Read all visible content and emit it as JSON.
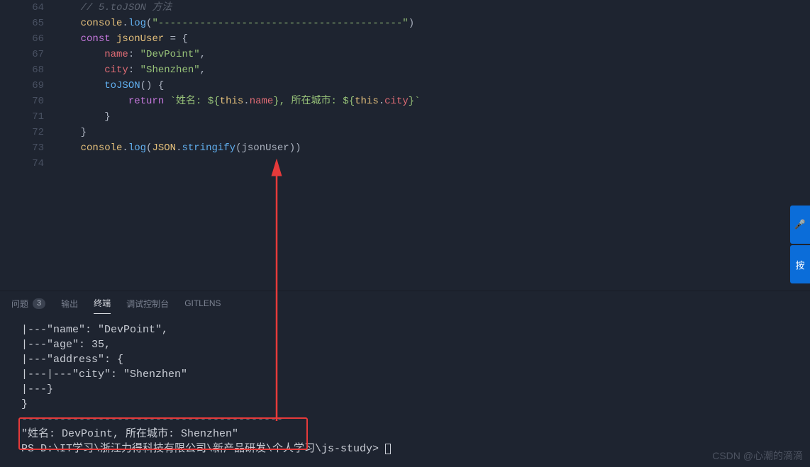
{
  "editor": {
    "lines": [
      {
        "num": "64",
        "indent": 1,
        "tokens": [
          {
            "t": "comment",
            "v": "// 5.toJSON 方法"
          }
        ]
      },
      {
        "num": "65",
        "indent": 1,
        "tokens": [
          {
            "t": "builtin",
            "v": "console"
          },
          {
            "t": "punct",
            "v": "."
          },
          {
            "t": "method",
            "v": "log"
          },
          {
            "t": "punct",
            "v": "("
          },
          {
            "t": "string",
            "v": "\"-----------------------------------------\""
          },
          {
            "t": "punct",
            "v": ")"
          }
        ]
      },
      {
        "num": "66",
        "indent": 1,
        "tokens": [
          {
            "t": "keyword",
            "v": "const"
          },
          {
            "t": "identifier",
            "v": " "
          },
          {
            "t": "builtin",
            "v": "jsonUser"
          },
          {
            "t": "identifier",
            "v": " "
          },
          {
            "t": "punct",
            "v": "="
          },
          {
            "t": "identifier",
            "v": " "
          },
          {
            "t": "punct",
            "v": "{"
          }
        ]
      },
      {
        "num": "67",
        "indent": 2,
        "tokens": [
          {
            "t": "prop",
            "v": "name"
          },
          {
            "t": "punct",
            "v": ": "
          },
          {
            "t": "string",
            "v": "\"DevPoint\""
          },
          {
            "t": "punct",
            "v": ","
          }
        ]
      },
      {
        "num": "68",
        "indent": 2,
        "tokens": [
          {
            "t": "prop",
            "v": "city"
          },
          {
            "t": "punct",
            "v": ": "
          },
          {
            "t": "string",
            "v": "\"Shenzhen\""
          },
          {
            "t": "punct",
            "v": ","
          }
        ]
      },
      {
        "num": "69",
        "indent": 2,
        "tokens": [
          {
            "t": "method",
            "v": "toJSON"
          },
          {
            "t": "punct",
            "v": "() {"
          }
        ]
      },
      {
        "num": "70",
        "indent": 3,
        "tokens": [
          {
            "t": "keyword",
            "v": "return"
          },
          {
            "t": "identifier",
            "v": " "
          },
          {
            "t": "string",
            "v": "`姓名: ${"
          },
          {
            "t": "thiskw",
            "v": "this"
          },
          {
            "t": "punct",
            "v": "."
          },
          {
            "t": "prop",
            "v": "name"
          },
          {
            "t": "string",
            "v": "}, 所在城市: ${"
          },
          {
            "t": "thiskw",
            "v": "this"
          },
          {
            "t": "punct",
            "v": "."
          },
          {
            "t": "prop",
            "v": "city"
          },
          {
            "t": "string",
            "v": "}`"
          }
        ]
      },
      {
        "num": "71",
        "indent": 2,
        "tokens": [
          {
            "t": "punct",
            "v": "}"
          }
        ]
      },
      {
        "num": "72",
        "indent": 1,
        "tokens": [
          {
            "t": "punct",
            "v": "}"
          }
        ]
      },
      {
        "num": "73",
        "indent": 1,
        "tokens": [
          {
            "t": "builtin",
            "v": "console"
          },
          {
            "t": "punct",
            "v": "."
          },
          {
            "t": "method",
            "v": "log"
          },
          {
            "t": "punct",
            "v": "("
          },
          {
            "t": "builtin",
            "v": "JSON"
          },
          {
            "t": "punct",
            "v": "."
          },
          {
            "t": "method",
            "v": "stringify"
          },
          {
            "t": "punct",
            "v": "("
          },
          {
            "t": "identifier",
            "v": "jsonUser"
          },
          {
            "t": "punct",
            "v": "))"
          }
        ]
      },
      {
        "num": "74",
        "indent": 0,
        "tokens": []
      }
    ]
  },
  "panel": {
    "tabs": {
      "problems": {
        "label": "问题",
        "count": "3",
        "active": false
      },
      "output": {
        "label": "输出",
        "active": false
      },
      "terminal": {
        "label": "终端",
        "active": true
      },
      "debug": {
        "label": "调试控制台",
        "active": false
      },
      "gitlens": {
        "label": "GITLENS",
        "active": false
      }
    },
    "terminal_lines": [
      "|---\"name\": \"DevPoint\",",
      "|---\"age\": 35,",
      "|---\"address\": {",
      "|---|---\"city\": \"Shenzhen\"",
      "|---}",
      "}",
      "-----------------------------------------",
      "\"姓名: DevPoint, 所在城市: Shenzhen\""
    ],
    "prompt": "PS D:\\IT学习\\浙江力得科技有限公司\\新产品研发\\个人学习\\js-study> "
  },
  "side": {
    "mic": "🎤",
    "key": "按"
  },
  "watermark": "CSDN @心潮的滴滴"
}
